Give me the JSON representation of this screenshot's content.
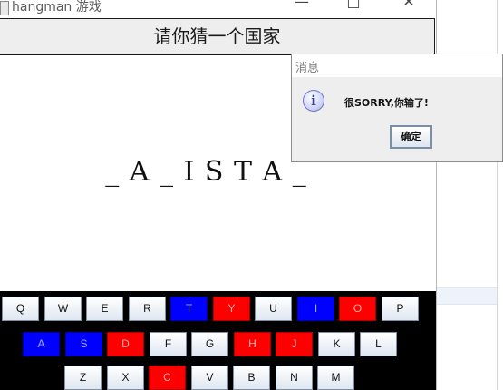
{
  "window": {
    "title": "hangman 游戏",
    "minimize": "—",
    "maximize": "□",
    "close": "✕"
  },
  "prompt": "请你猜一个国家",
  "word_display": "_ A _ I S T A _",
  "keyboard": {
    "rows": [
      [
        {
          "letter": "Q",
          "state": "unused"
        },
        {
          "letter": "W",
          "state": "unused"
        },
        {
          "letter": "E",
          "state": "unused"
        },
        {
          "letter": "R",
          "state": "unused"
        },
        {
          "letter": "T",
          "state": "correct"
        },
        {
          "letter": "Y",
          "state": "wrong"
        },
        {
          "letter": "U",
          "state": "unused"
        },
        {
          "letter": "I",
          "state": "correct"
        },
        {
          "letter": "O",
          "state": "wrong"
        },
        {
          "letter": "P",
          "state": "unused"
        }
      ],
      [
        {
          "letter": "A",
          "state": "correct"
        },
        {
          "letter": "S",
          "state": "correct"
        },
        {
          "letter": "D",
          "state": "wrong"
        },
        {
          "letter": "F",
          "state": "unused"
        },
        {
          "letter": "G",
          "state": "unused"
        },
        {
          "letter": "H",
          "state": "wrong"
        },
        {
          "letter": "J",
          "state": "wrong"
        },
        {
          "letter": "K",
          "state": "unused"
        },
        {
          "letter": "L",
          "state": "unused"
        }
      ],
      [
        {
          "letter": "Z",
          "state": "unused"
        },
        {
          "letter": "X",
          "state": "unused"
        },
        {
          "letter": "C",
          "state": "wrong"
        },
        {
          "letter": "V",
          "state": "unused"
        },
        {
          "letter": "B",
          "state": "unused"
        },
        {
          "letter": "N",
          "state": "unused"
        },
        {
          "letter": "M",
          "state": "unused"
        }
      ]
    ],
    "colors": {
      "correct": "#0000ff",
      "wrong": "#ff0000",
      "panel": "#000000"
    }
  },
  "dialog": {
    "title": "消息",
    "icon": "info-icon",
    "icon_glyph": "i",
    "message": "很SORRY,你输了!",
    "ok_label": "确定"
  }
}
